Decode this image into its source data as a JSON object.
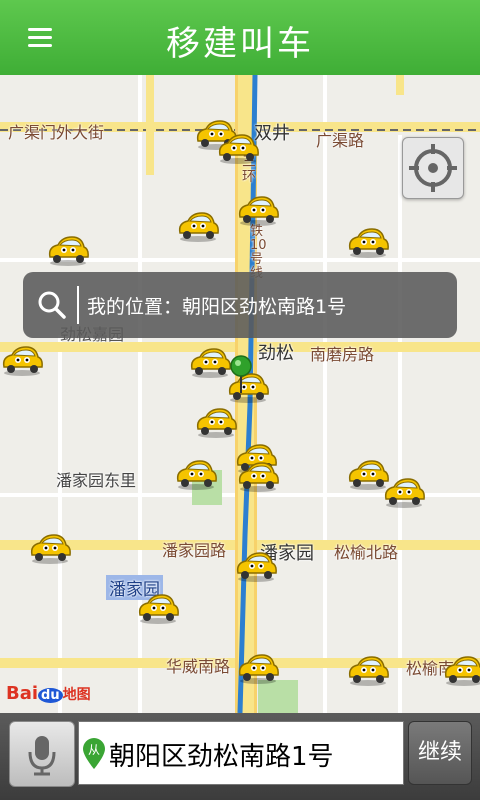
{
  "header": {
    "title": "移建叫车",
    "menu_icon": "menu-icon"
  },
  "search": {
    "text": "我的位置：朝阳区劲松南路1号",
    "icon": "search-icon"
  },
  "map": {
    "labels": {
      "guangqumenwai": "广渠门外大街",
      "shuangjing": "双井",
      "guangqu_road": "广渠路",
      "sanhuan": "三环",
      "line10": "铁10号线",
      "jinsong_jiayuan": "劲松嘉园",
      "jinsong": "劲松",
      "nanmofang": "南磨房路",
      "panjiayuan_dongli": "潘家园东里",
      "panjiayuan_road": "潘家园路",
      "panjiayuan_station": "潘家园",
      "songyu_north": "松榆北路",
      "panjiayuan_area": "潘家园",
      "huawei_south": "华威南路",
      "songyu_south": "松榆南"
    },
    "logo": {
      "bai": "Bai",
      "du": "du",
      "ditu": "地图"
    }
  },
  "bottom": {
    "mic_icon": "microphone-icon",
    "from_badge": "从",
    "address": "朝阳区劲松南路1号",
    "continue_label": "继续"
  },
  "colors": {
    "header": "#45b33a",
    "taxi": "#f5c400",
    "road_major": "#f8e58a",
    "metro": "#2c7fd0",
    "pin": "#2fa12b"
  }
}
